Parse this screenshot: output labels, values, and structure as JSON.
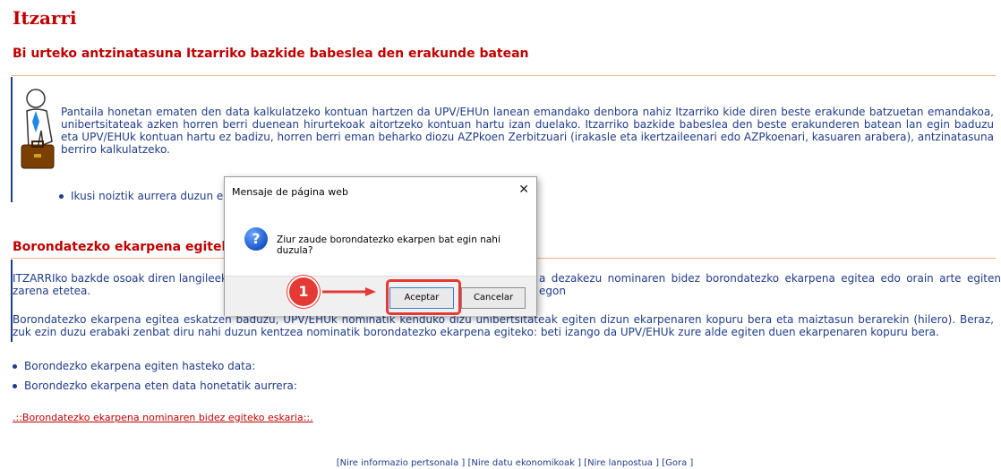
{
  "page": {
    "title": "Itzarri",
    "section1_title": "Bi urteko antzinatasuna Itzarriko bazkide babeslea den erakunde batean",
    "section1_paragraph": "Pantaila honetan ematen den data kalkulatzeko kontuan hartzen da UPV/EHUn lanean emandako denbora nahiz Itzarriko kide diren beste erakunde batzuetan emandakoa, unibertsitateak azken horren berri duenean hirurtekoak aitortzeko kontuan hartu izan duelako. Itzarriko bazkide babeslea den beste erakunderen batean lan egin baduzu eta UPV/EHUk kontuan hartu ez badizu, horren berri eman beharko diozu AZPkoen Zerbitzuari (irakasle eta ikertzaileenari edo AZPkoenari, kasuaren arabera), antzinatasuna berriro kalkulatzeko.",
    "section1_bullet": "Ikusi noiztik aurrera duzun ec",
    "section2_title": "Borondatezko ekarpena egiteko e",
    "section2_para1_left": "ITZARRIko bazkde osoak diren langileek",
    "section2_para1_right": "a dezakezu nominaren bidez borondatezko ekarpena egitea edo orain arte egiten egon",
    "section2_para1_tail": "zarena etetea.",
    "section2_para2": "Borondatezko ekarpena egitea eskatzen baduzu, UPV/EHUk nominatik kenduko dizu unibertsitateak egiten dizun ekarpenaren kopuru bera eta maiztasun berarekin (hilero). Beraz, zuk ezin duzu erabaki zenbat diru nahi duzun kentzea nominatik borondatezko ekarpena egiteko: beti izango da UPV/EHUk zure alde egiten duen ekarpenaren kopuru bera.",
    "bullet_start": "Borondezko ekarpena egiten hasteko data:",
    "bullet_stop": "Borondezko ekarpena eten data honetatik aurrera:",
    "request_link": ".::Borondatezko ekarpena nominaren bidez egiteko eskaria::.",
    "footer_links": [
      "[Nire informazio pertsonala ]",
      "[Nire datu ekonomikoak ]",
      "[Nire lanpostua ]",
      "[Gora ]"
    ]
  },
  "dialog": {
    "title": "Mensaje de página web",
    "close": "✕",
    "message": "Ziur zaude borondatezko ekarpen bat egin nahi duzula?",
    "icon": "question-icon",
    "accept_label": "Aceptar",
    "cancel_label": "Cancelar"
  },
  "annotation": {
    "step": "1"
  },
  "colors": {
    "title_red": "#c00000",
    "text_blue": "#1f3c88",
    "annotation_red": "#e53935"
  }
}
